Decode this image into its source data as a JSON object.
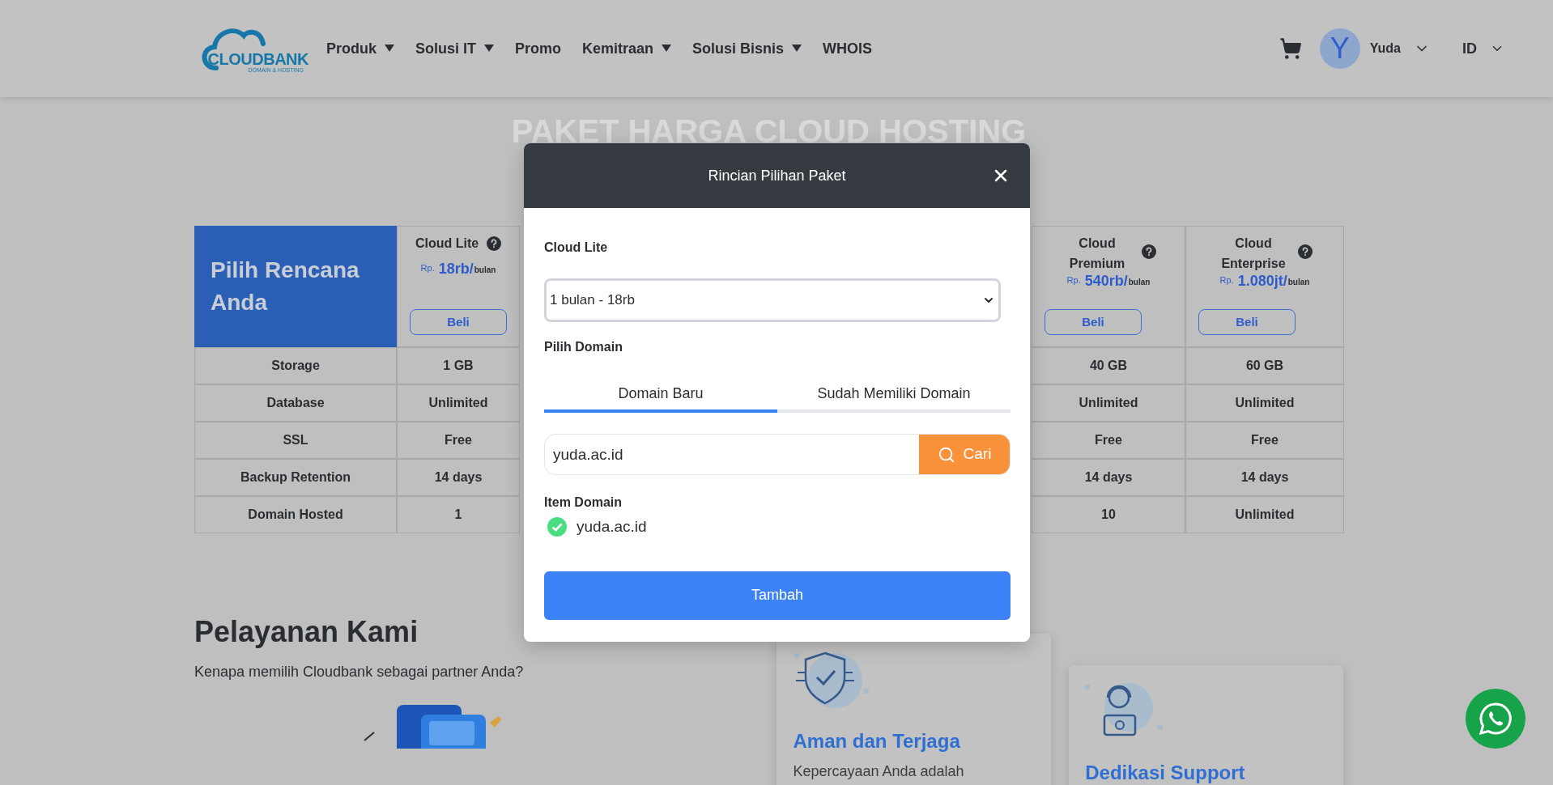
{
  "header": {
    "logo": {
      "name": "CLOUDBANK",
      "tagline": "DOMAIN & HOSTING"
    },
    "nav": [
      {
        "label": "Produk",
        "dropdown": true
      },
      {
        "label": "Solusi IT",
        "dropdown": true
      },
      {
        "label": "Promo",
        "dropdown": false
      },
      {
        "label": "Kemitraan",
        "dropdown": true
      },
      {
        "label": "Solusi Bisnis",
        "dropdown": true
      },
      {
        "label": "WHOIS",
        "dropdown": false
      }
    ],
    "user": {
      "initial": "Y",
      "name": "Yuda"
    },
    "language": "ID"
  },
  "page_heading": {
    "background_title": "PAKET HARGA CLOUD HOSTING"
  },
  "pricing_table": {
    "corner": "Pilih Rencana Anda",
    "plans": [
      {
        "name": "Cloud Lite",
        "currency": "Rp.",
        "price": "18rb/",
        "period": "bulan",
        "button": "Beli"
      },
      {
        "name": "Cloud Premium",
        "currency": "Rp.",
        "price": "540rb/",
        "period": "bulan",
        "button": "Beli"
      },
      {
        "name": "Cloud Enterprise",
        "currency": "Rp.",
        "price": "1.080jt/",
        "period": "bulan",
        "button": "Beli"
      }
    ],
    "rows": [
      {
        "label": "Storage",
        "values": [
          "1 GB",
          "40 GB",
          "60 GB"
        ]
      },
      {
        "label": "Database",
        "values": [
          "Unlimited",
          "Unlimited",
          "Unlimited"
        ]
      },
      {
        "label": "SSL",
        "values": [
          "Free",
          "Free",
          "Free"
        ]
      },
      {
        "label": "Backup Retention",
        "values": [
          "14 days",
          "14 days",
          "14 days"
        ]
      },
      {
        "label": "Domain Hosted",
        "values": [
          "1",
          "10",
          "Unlimited"
        ]
      }
    ]
  },
  "services": {
    "title": "Pelayanan Kami",
    "subtitle": "Kenapa memilih Cloudbank sebagai partner Anda?",
    "cards": [
      {
        "kind": "security",
        "title": "Aman dan Terjaga",
        "text": "Kepercayaan Anda adalah"
      },
      {
        "kind": "support",
        "title": "Dedikasi Support"
      }
    ]
  },
  "modal": {
    "title": "Rincian Pilihan Paket",
    "plan": "Cloud Lite",
    "duration": "1 bulan - 18rb",
    "domain_label": "Pilih Domain",
    "tabs": [
      {
        "label": "Domain Baru",
        "selected": true
      },
      {
        "label": "Sudah Memiliki Domain",
        "selected": false
      }
    ],
    "search": {
      "value": "yuda.ac.id",
      "button": "Cari"
    },
    "items_label": "Item Domain",
    "items": [
      {
        "domain": "yuda.ac.id",
        "available": true
      }
    ],
    "submit": "Tambah"
  }
}
